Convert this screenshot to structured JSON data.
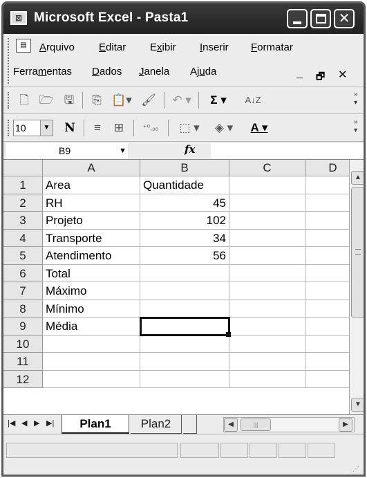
{
  "window": {
    "title": "Microsoft Excel - Pasta1"
  },
  "menu": {
    "items": [
      "Arquivo",
      "Editar",
      "Exibir",
      "Inserir",
      "Formatar",
      "Ferramentas",
      "Dados",
      "Janela",
      "Ajuda"
    ]
  },
  "toolbar": {
    "font_size": "10",
    "bold_label": "N",
    "sum_symbol": "Σ",
    "sort_label": "A↓Z",
    "decimal_label": "⁺⁰,₀₀",
    "font_color_label": "A"
  },
  "formula_bar": {
    "name_box": "B9",
    "fx_label": "fx",
    "content": ""
  },
  "grid": {
    "columns": [
      "A",
      "B",
      "C",
      "D"
    ],
    "rows": [
      "1",
      "2",
      "3",
      "4",
      "5",
      "6",
      "7",
      "8",
      "9",
      "10",
      "11",
      "12"
    ],
    "cells": [
      [
        "Area",
        "Quantidade"
      ],
      [
        "RH",
        "45"
      ],
      [
        "Projeto",
        "102"
      ],
      [
        "Transporte",
        "34"
      ],
      [
        "Atendimento",
        "56"
      ],
      [
        "Total",
        ""
      ],
      [
        "Máximo",
        ""
      ],
      [
        "Mínimo",
        ""
      ],
      [
        "Média",
        ""
      ],
      [
        "",
        ""
      ],
      [
        "",
        ""
      ],
      [
        "",
        ""
      ]
    ],
    "selected_cell": "B9"
  },
  "sheets": {
    "tabs": [
      "Plan1",
      "Plan2"
    ],
    "active": "Plan1"
  }
}
